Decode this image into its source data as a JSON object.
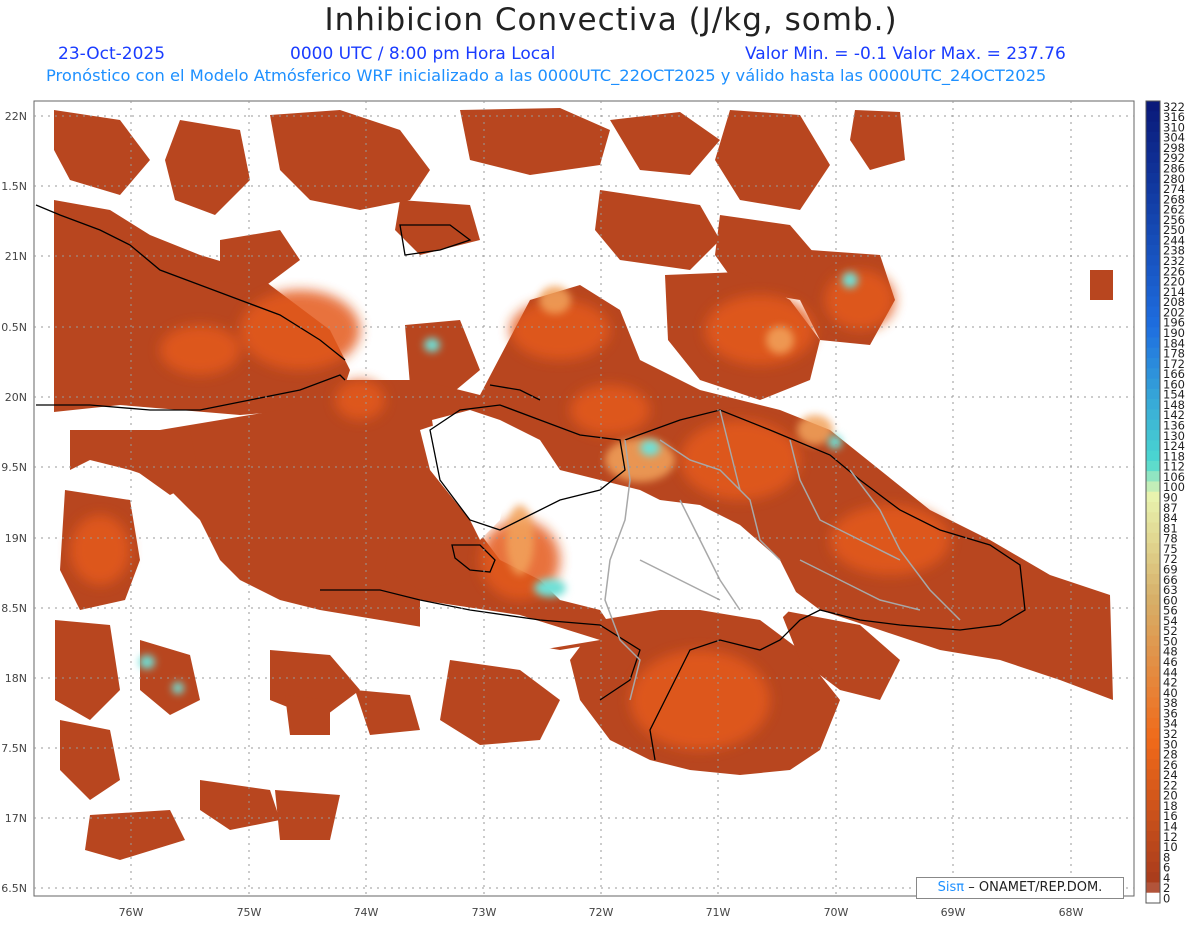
{
  "header": {
    "title": "Inhibicion Convectiva (J/kg, somb.)",
    "date": "23-Oct-2025",
    "time": "0000 UTC / 8:00 pm Hora Local",
    "minmax": "Valor Min. = -0.1  Valor Max. = 237.76",
    "subtitle": "Pronóstico con el Modelo Atmósferico WRF inicializado a las 0000UTC_22OCT2025 y válido hasta las  0000UTC_24OCT2025"
  },
  "axes": {
    "lat_labels": [
      "22N",
      "1.5N",
      "21N",
      "0.5N",
      "20N",
      "9.5N",
      "19N",
      "8.5N",
      "18N",
      "7.5N",
      "17N",
      "6.5N"
    ],
    "lon_labels": [
      "76W",
      "75W",
      "74W",
      "73W",
      "72W",
      "71W",
      "70W",
      "69W",
      "68W"
    ]
  },
  "colorbar": {
    "labels": [
      "322",
      "316",
      "310",
      "304",
      "298",
      "292",
      "286",
      "280",
      "274",
      "268",
      "262",
      "256",
      "250",
      "244",
      "238",
      "232",
      "226",
      "220",
      "214",
      "208",
      "202",
      "196",
      "190",
      "184",
      "178",
      "172",
      "166",
      "160",
      "154",
      "148",
      "142",
      "136",
      "130",
      "124",
      "118",
      "112",
      "106",
      "100",
      "90",
      "87",
      "84",
      "81",
      "78",
      "75",
      "72",
      "69",
      "66",
      "63",
      "60",
      "56",
      "54",
      "52",
      "50",
      "48",
      "46",
      "44",
      "42",
      "40",
      "38",
      "36",
      "34",
      "32",
      "30",
      "28",
      "26",
      "24",
      "22",
      "20",
      "18",
      "16",
      "14",
      "12",
      "10",
      "8",
      "6",
      "4",
      "2",
      "0"
    ],
    "colors": {
      "high": "#0a1a7a",
      "upper": "#1e6ee0",
      "mid": "#4cd9d0",
      "pale": "#e8f5b0",
      "tan": "#d7b06a",
      "orange": "#f06a1a",
      "brown": "#a63a1c",
      "zero": "#ffffff"
    }
  },
  "field": {
    "base_color": "#b8461f",
    "hot_color": "#e45a1c",
    "light_color": "#f2a35c",
    "cyan_color": "#6fe0d6",
    "coast_color": "#000000",
    "border_color": "#a8a8a8"
  },
  "credit": {
    "sis": "Sisπ",
    "org": "– ONAMET/REP.DOM."
  }
}
